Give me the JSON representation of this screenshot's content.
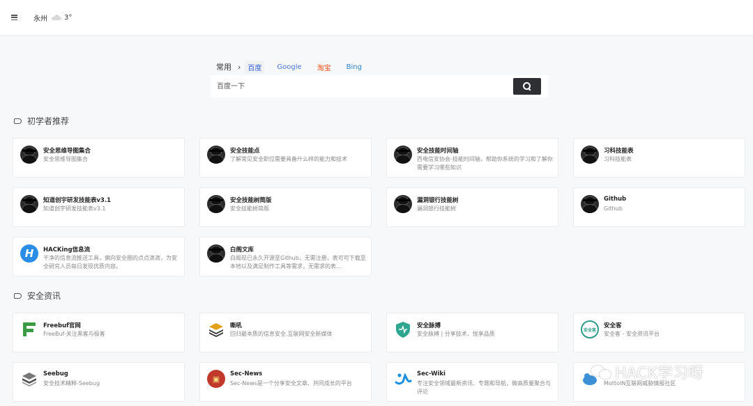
{
  "header": {
    "city": "永州",
    "temperature": "3°",
    "weather_icon": "cloud-icon",
    "menu_icon": "hamburger-menu-icon"
  },
  "search": {
    "group_label": "常用",
    "engines": [
      {
        "label": "百度",
        "color": "#2c5cd6",
        "active": true
      },
      {
        "label": "Google",
        "color": "#4a78d8",
        "active": false
      },
      {
        "label": "淘宝",
        "color": "#f04a13",
        "active": false
      },
      {
        "label": "Bing",
        "color": "#2b7fc4",
        "active": false
      }
    ],
    "placeholder": "百度一下",
    "button_icon": "search-icon"
  },
  "sections": [
    {
      "title": "初学者推荐",
      "cards": [
        {
          "title": "安全思维导图集合",
          "desc": "安全思维导图集合"
        },
        {
          "title": "安全技能点",
          "desc": "了解常见安全职位需要具备什么样的能力和技术"
        },
        {
          "title": "安全技能时间轴",
          "desc": "西电信安协会-技能时间轴，帮助你系统的学习和了解你需要学习哪些知识"
        },
        {
          "title": "习科技能表",
          "desc": "习科技能表"
        },
        {
          "title": "知道创宇研发技能表v3.1",
          "desc": "知道创宇研发技能表v3.1"
        },
        {
          "title": "安全技能树简版",
          "desc": "安全技能树简版"
        },
        {
          "title": "漏洞银行技能树",
          "desc": "漏洞银行技能树"
        },
        {
          "title": "Github",
          "desc": "Github"
        },
        {
          "title": "HACKing信息流",
          "desc": "干净的信息流推送工具，偏向安全圈的点点滴滴，为安全研究人员每日发现优质内容。"
        },
        {
          "title": "白阁文库",
          "desc": "白阁现已永久开源至Github，无需注册，表可可下载至本地以及满足制作工具等需求，无需求的表..."
        }
      ]
    },
    {
      "title": "安全资讯",
      "cards": [
        {
          "title": "Freebuf官网",
          "desc": "FreeBuf-关注黑客与极客"
        },
        {
          "title": "嘶吼",
          "desc": "回归最本质的信息安全,互联网安全新媒体"
        },
        {
          "title": "安全脉搏",
          "desc": "安全脉搏 | 分享技术，悦享品质"
        },
        {
          "title": "安全客",
          "desc": "安全客 - 安全资讯平台"
        },
        {
          "title": "Seebug",
          "desc": "安全技术精粹-Seebug"
        },
        {
          "title": "Sec-News",
          "desc": "Sec-News是一个分享安全文章、共同成长的平台"
        },
        {
          "title": "Sec-Wiki",
          "desc": "专注安全领域最新资讯、专题和导航，做高质量聚合与评论"
        },
        {
          "title": "",
          "desc": "MottoIN互联网威胁情报社区"
        }
      ]
    }
  ],
  "icons": {
    "section_icon": "tag-icon",
    "anquanke_text": "安全客"
  },
  "watermark": {
    "text": "HACK学习呀",
    "icon": "wechat-icon"
  }
}
